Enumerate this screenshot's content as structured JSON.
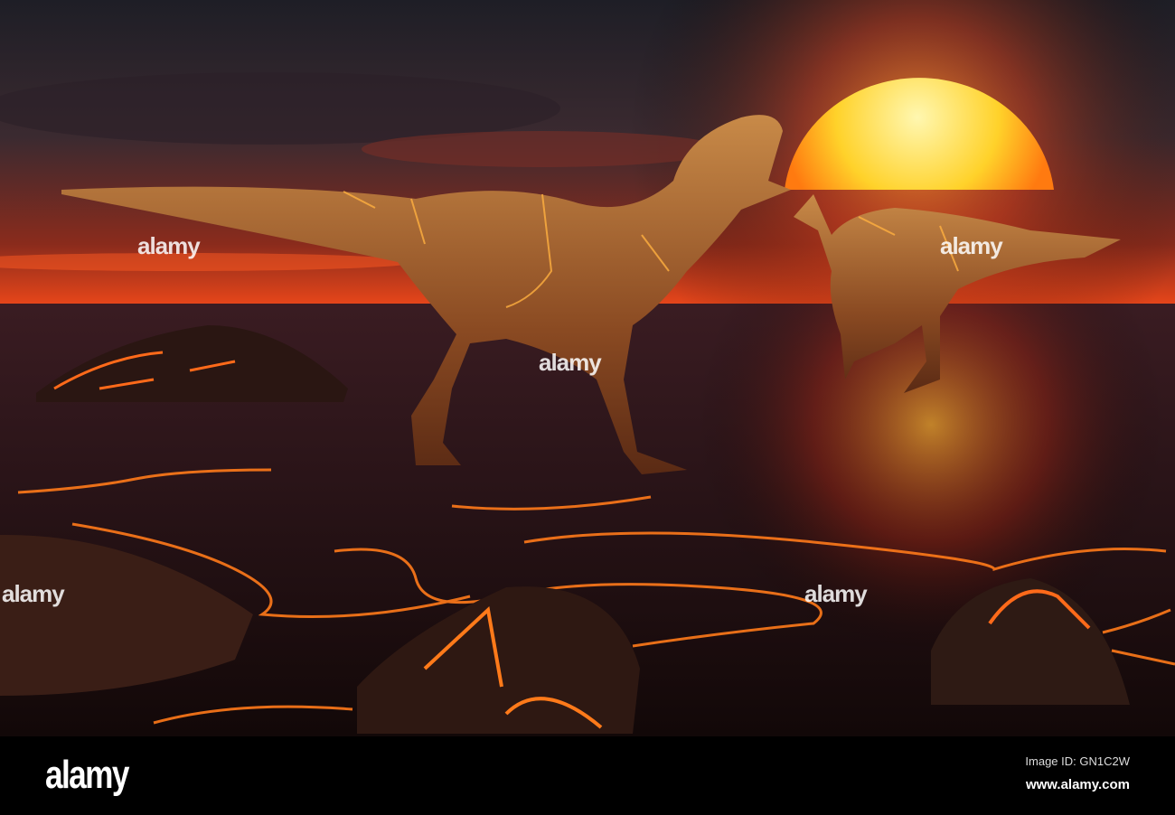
{
  "footer": {
    "logo": "alamy",
    "image_id": "Image ID: GN1C2W",
    "website": "www.alamy.com"
  },
  "watermark": "alamy",
  "colors": {
    "sky_top": "#24242c",
    "horizon": "#e0401a",
    "sun": "#ffe66a",
    "lava": "#ff7a1a"
  }
}
